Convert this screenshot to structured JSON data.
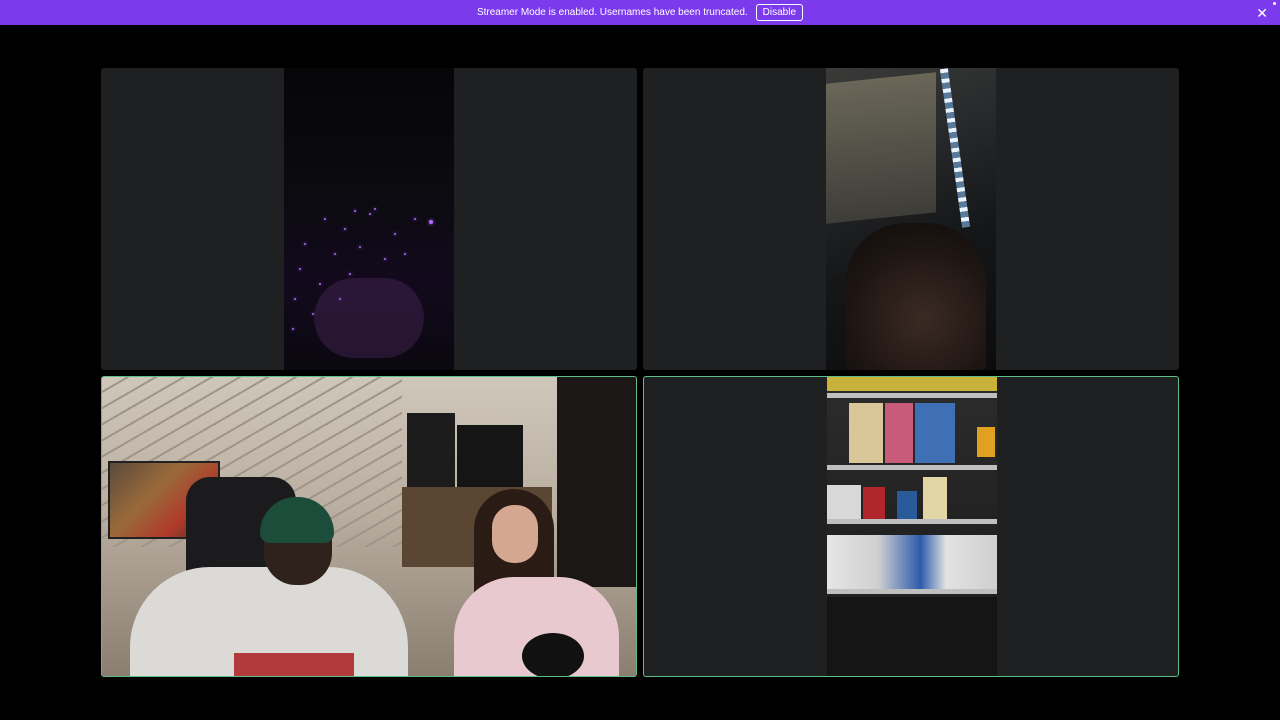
{
  "banner": {
    "message": "Streamer Mode is enabled. Usernames have been truncated.",
    "disable_label": "Disable",
    "close_icon": "close-icon",
    "background_color": "#7c3aed"
  },
  "tiles": [
    {
      "id": "participant-1",
      "speaking": false
    },
    {
      "id": "participant-2",
      "speaking": false
    },
    {
      "id": "participant-3",
      "speaking": true
    },
    {
      "id": "participant-4",
      "speaking": true
    }
  ],
  "colors": {
    "tile_background": "#1f2022",
    "speaking_border": "#5fbf8a",
    "page_background": "#000000"
  }
}
